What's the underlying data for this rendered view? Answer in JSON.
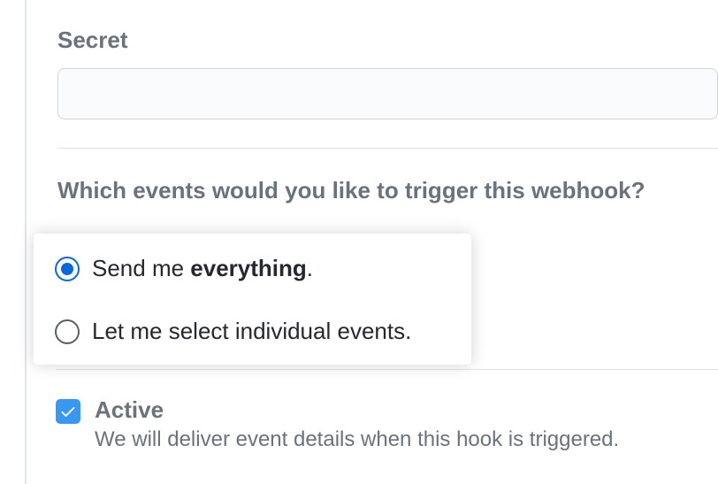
{
  "secret": {
    "label": "Secret",
    "value": ""
  },
  "events": {
    "question": "Which events would you like to trigger this webhook?",
    "options": [
      {
        "prefix": "Send me ",
        "bold": "everything",
        "suffix": ".",
        "selected": true
      },
      {
        "prefix": "Let me select individual events.",
        "bold": "",
        "suffix": "",
        "selected": false
      }
    ]
  },
  "active": {
    "label": "Active",
    "description": "We will deliver event details when this hook is triggered.",
    "checked": true
  }
}
